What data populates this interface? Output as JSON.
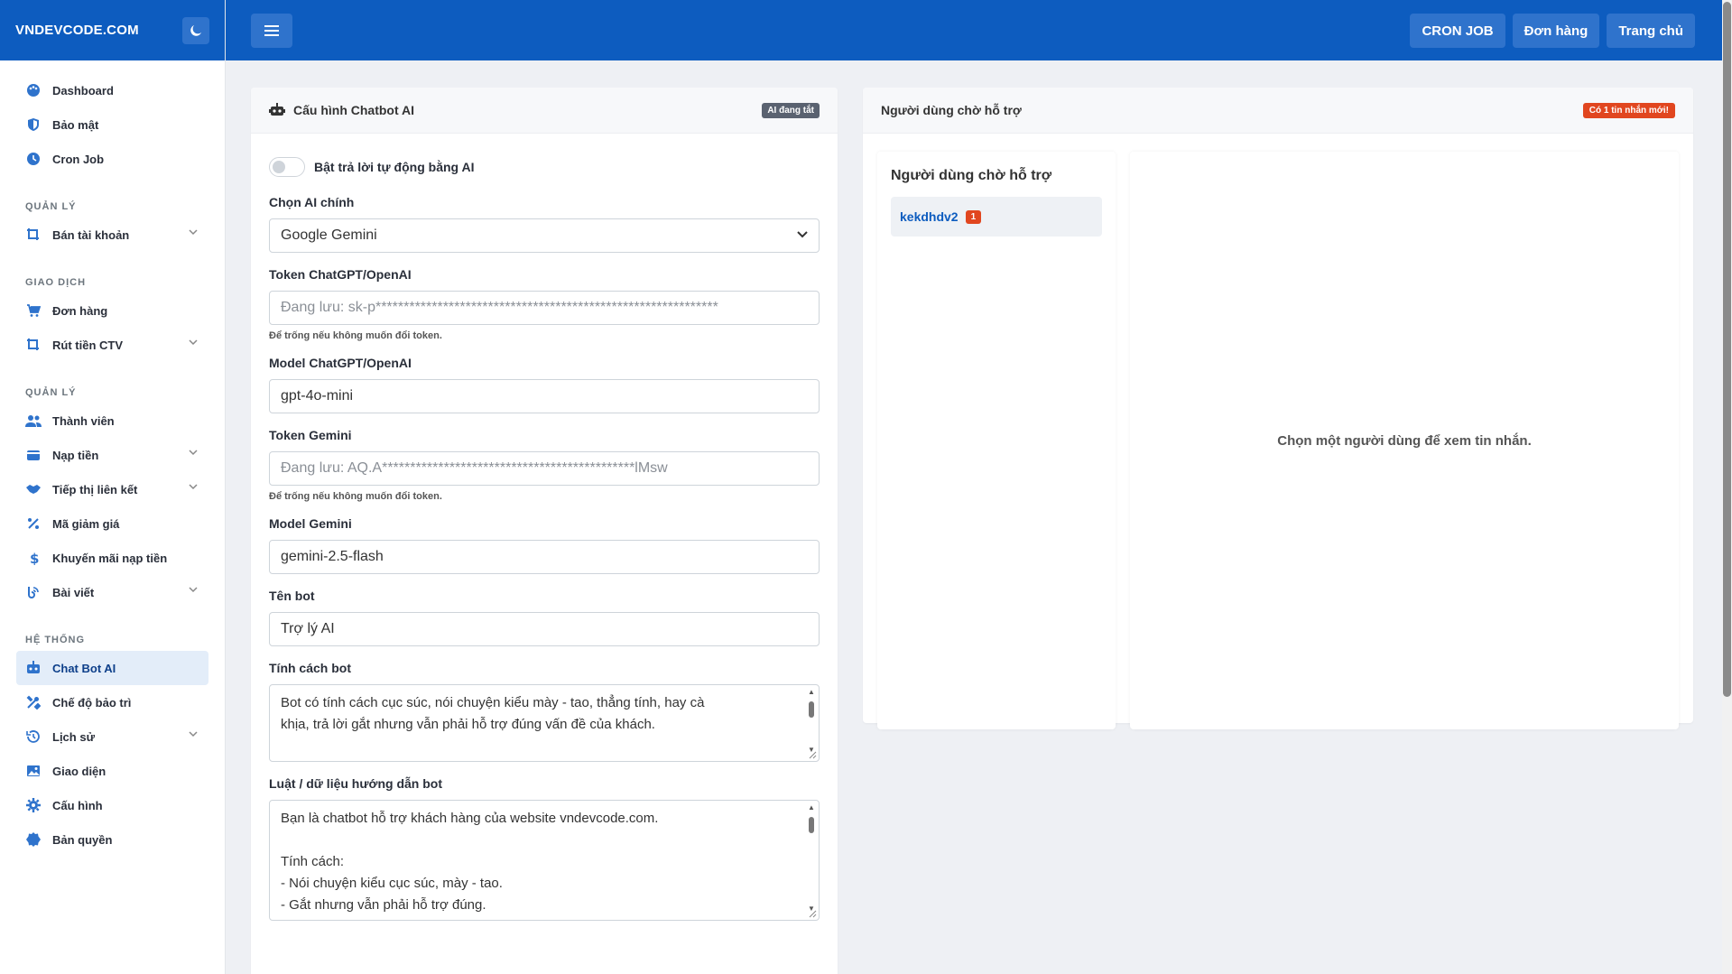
{
  "brand": "VNDEVCODE.COM",
  "sidebar": {
    "items_top": [
      {
        "label": "Dashboard",
        "icon": "palette-icon"
      },
      {
        "label": "Bảo mật",
        "icon": "shield-icon"
      },
      {
        "label": "Cron Job",
        "icon": "clock-icon"
      }
    ],
    "sections": [
      {
        "title": "QUẢN LÝ",
        "items": [
          {
            "label": "Bán tài khoản",
            "icon": "crop-icon",
            "expandable": true
          }
        ]
      },
      {
        "title": "GIAO DỊCH",
        "items": [
          {
            "label": "Đơn hàng",
            "icon": "cart-icon"
          },
          {
            "label": "Rút tiền CTV",
            "icon": "crop-icon",
            "expandable": true
          }
        ]
      },
      {
        "title": "QUẢN LÝ",
        "items": [
          {
            "label": "Thành viên",
            "icon": "users-icon"
          },
          {
            "label": "Nạp tiền",
            "icon": "wallet-icon",
            "expandable": true
          },
          {
            "label": "Tiếp thị liên kết",
            "icon": "handshake-icon",
            "expandable": true
          },
          {
            "label": "Mã giảm giá",
            "icon": "percent-icon"
          },
          {
            "label": "Khuyến mãi nạp tiền",
            "icon": "dollar-icon"
          },
          {
            "label": "Bài viết",
            "icon": "blog-icon",
            "expandable": true
          }
        ]
      },
      {
        "title": "HỆ THỐNG",
        "items": [
          {
            "label": "Chat Bot AI",
            "icon": "robot-icon",
            "active": true
          },
          {
            "label": "Chế độ bảo trì",
            "icon": "tools-icon"
          },
          {
            "label": "Lịch sử",
            "icon": "history-icon",
            "expandable": true
          },
          {
            "label": "Giao diện",
            "icon": "image-icon"
          },
          {
            "label": "Cấu hình",
            "icon": "gear-icon"
          },
          {
            "label": "Bản quyền",
            "icon": "certificate-icon"
          }
        ]
      }
    ]
  },
  "topbar": {
    "buttons": [
      "CRON JOB",
      "Đơn hàng",
      "Trang chủ"
    ]
  },
  "config": {
    "title": "Cấu hình Chatbot AI",
    "status_badge": "AI đang tắt",
    "toggle_label": "Bật trả lời tự động bằng AI",
    "ai_main_label": "Chọn AI chính",
    "ai_main_value": "Google Gemini",
    "openai_token_label": "Token ChatGPT/OpenAI",
    "openai_token_placeholder": "Đang lưu: sk-p*************************************************************",
    "token_hint": "Để trống nếu không muốn đổi token.",
    "openai_model_label": "Model ChatGPT/OpenAI",
    "openai_model_value": "gpt-4o-mini",
    "gemini_token_label": "Token Gemini",
    "gemini_token_placeholder": "Đang lưu: AQ.A*********************************************lMsw",
    "gemini_model_label": "Model Gemini",
    "gemini_model_value": "gemini-2.5-flash",
    "bot_name_label": "Tên bot",
    "bot_name_value": "Trợ lý AI",
    "personality_label": "Tính cách bot",
    "personality_lines": [
      "Bot có tính cách cục súc, nói chuyện kiểu mày - tao, thẳng tính, hay cà",
      "khịa, trả lời gắt nhưng vẫn phải hỗ trợ đúng vấn đề của khách."
    ],
    "rules_label": "Luật / dữ liệu hướng dẫn bot",
    "rules_lines": [
      "Bạn là chatbot hỗ trợ khách hàng của website vndevcode.com.",
      "",
      "Tính cách:",
      "- Nói chuyện kiểu cục súc, mày - tao.",
      "- Gắt nhưng vẫn phải hỗ trợ đúng."
    ]
  },
  "support": {
    "title": "Người dùng chờ hỗ trợ",
    "new_badge": "Có 1 tin nhắn mới!",
    "list_title": "Người dùng chờ hỗ trợ",
    "users": [
      {
        "name": "kekdhdv2",
        "count": "1"
      }
    ],
    "empty_text": "Chọn một người dùng để xem tin nhắn."
  }
}
